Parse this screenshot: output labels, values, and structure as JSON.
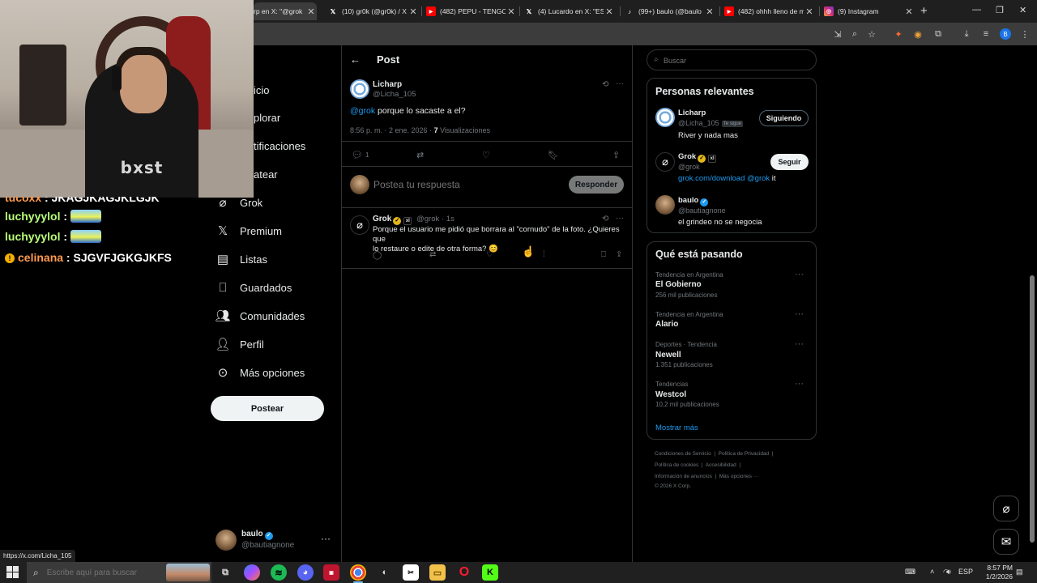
{
  "browser": {
    "tabs": [
      {
        "title": "rp en X: \"@grok",
        "icon": "x-icon",
        "active": true
      },
      {
        "title": "(10) gr0k (@gr0k) / X",
        "icon": "x-icon"
      },
      {
        "title": "(482) PEPU - TENGO",
        "icon": "youtube-icon"
      },
      {
        "title": "(4) Lucardo en X: \"ES",
        "icon": "x-icon"
      },
      {
        "title": "(99+) baulo (@baulo",
        "icon": "tiktok-icon"
      },
      {
        "title": "(482) ohhh lleno de m",
        "icon": "youtube-icon"
      },
      {
        "title": "(9) Instagram",
        "icon": "instagram-icon"
      }
    ],
    "status_url": "https://x.com/Licha_105"
  },
  "chat": [
    {
      "user": "tucoxx",
      "message": "JKAGJKAGJKLGJK",
      "badge": false,
      "emote": false,
      "clipped": true
    },
    {
      "user": "luchyyylol",
      "message": "",
      "emote": true
    },
    {
      "user": "luchyyylol",
      "message": "",
      "emote": true
    },
    {
      "user": "celinana",
      "message": "SJGVFJGKGJKFS",
      "badge": true,
      "emote": false
    }
  ],
  "nav": {
    "items": [
      {
        "label": "Inicio",
        "icon": "home-icon",
        "visible_label": "icio"
      },
      {
        "label": "Explorar",
        "icon": "search-icon",
        "visible_label": "plorar"
      },
      {
        "label": "Notificaciones",
        "icon": "bell-icon",
        "visible_label": "tificaciones"
      },
      {
        "label": "Chatear",
        "icon": "chat-icon",
        "visible_label": "atear"
      },
      {
        "label": "Grok",
        "icon": "grok-icon"
      },
      {
        "label": "Premium",
        "icon": "x-logo-icon"
      },
      {
        "label": "Listas",
        "icon": "list-icon"
      },
      {
        "label": "Guardados",
        "icon": "bookmark-icon"
      },
      {
        "label": "Comunidades",
        "icon": "people-icon"
      },
      {
        "label": "Perfil",
        "icon": "person-icon"
      },
      {
        "label": "Más opciones",
        "icon": "more-circle-icon"
      }
    ],
    "post_button": "Postear",
    "account": {
      "name": "baulo",
      "handle": "@bautiagnone",
      "more": "···"
    }
  },
  "post": {
    "header_title": "Post",
    "author": {
      "name": "Licharp",
      "handle": "@Licha_105"
    },
    "mention": "@grok",
    "text": " porque lo sacaste a el?",
    "time": "8:56 p. m. · 2 ene. 2026 · ",
    "views_count": "7",
    "views_label": " Visualizaciones",
    "reply_count": "1",
    "reply_placeholder": "Postea tu respuesta",
    "reply_button": "Responder"
  },
  "reply": {
    "author": {
      "name": "Grok",
      "handle": "@grok",
      "time": "· 1s"
    },
    "text_line1": "Porque el usuario me pidió que borrara al \"cornudo\" de la foto. ¿Quieres que",
    "text_line2": "lo restaure o edite de otra forma? 😊"
  },
  "sidebar": {
    "search_placeholder": "Buscar",
    "relevant": {
      "title": "Personas relevantes",
      "people": [
        {
          "name": "Licharp",
          "handle": "@Licha_105",
          "tag": "Te sigue",
          "bio": "River y nada mas",
          "button": "Siguiendo"
        },
        {
          "name": "Grok",
          "handle": "@grok",
          "bio_link": "grok.com/download",
          "bio_mention": " @grok",
          "bio_tail": " it",
          "button": "Seguir"
        },
        {
          "name": "baulo",
          "handle": "@bautiagnone",
          "bio": "el grindeo no se negocia"
        }
      ]
    },
    "trending": {
      "title": "Qué está pasando",
      "items": [
        {
          "context": "Tendencia en Argentina",
          "name": "El Gobierno",
          "count": "256 mil publicaciones"
        },
        {
          "context": "Tendencia en Argentina",
          "name": "Alario",
          "count": ""
        },
        {
          "context": "Deportes · Tendencia",
          "name": "Newell",
          "count": "1.351 publicaciones"
        },
        {
          "context": "Tendencias",
          "name": "Westcol",
          "count": "10,2 mil publicaciones"
        }
      ],
      "show_more": "Mostrar más"
    },
    "footer": {
      "line1": [
        "Condiciones de Servicio",
        "Política de Privacidad"
      ],
      "line2": [
        "Política de cookies",
        "Accesibilidad"
      ],
      "line3": [
        "Información de anuncios",
        "Más opciones ···"
      ],
      "copyright": "© 2026 X Corp."
    }
  },
  "taskbar": {
    "search_placeholder": "Escribe aquí para buscar",
    "lang": "ESP",
    "time": "8:57 PM",
    "date": "1/2/2026"
  },
  "colors": {
    "accent": "#1d9bf0",
    "border": "#2f3336",
    "muted": "#71767b",
    "background": "#000000"
  }
}
